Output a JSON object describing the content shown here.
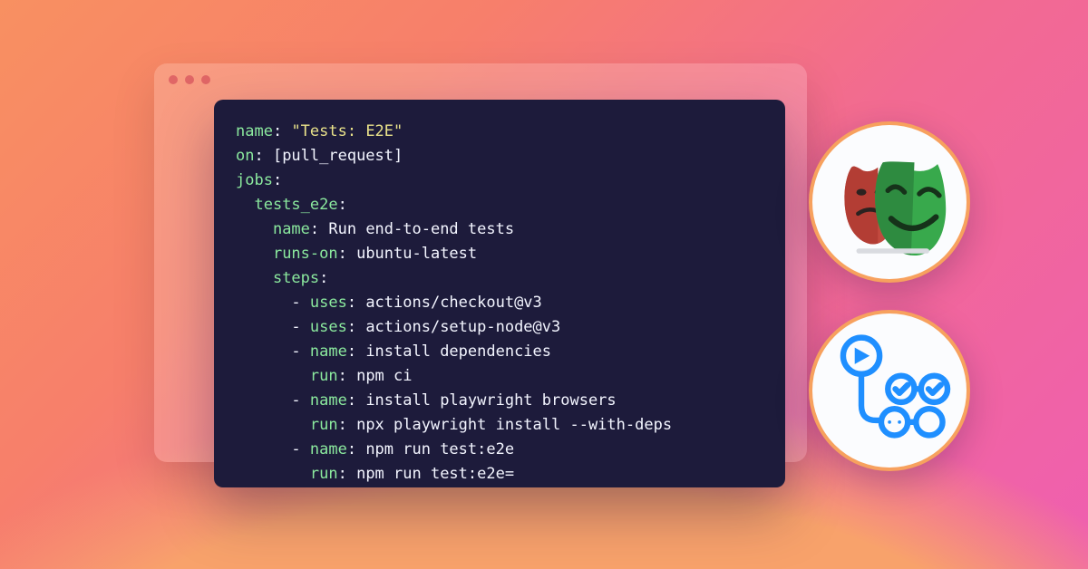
{
  "code": {
    "lines": [
      [
        {
          "cls": "k",
          "t": "name"
        },
        {
          "cls": "s",
          "t": ": "
        },
        {
          "cls": "q",
          "t": "\"Tests: E2E\""
        }
      ],
      [
        {
          "cls": "k",
          "t": "on"
        },
        {
          "cls": "s",
          "t": ": [pull_request]"
        }
      ],
      [
        {
          "cls": "k",
          "t": "jobs"
        },
        {
          "cls": "s",
          "t": ":"
        }
      ],
      [
        {
          "cls": "s",
          "t": "  "
        },
        {
          "cls": "k",
          "t": "tests_e2e"
        },
        {
          "cls": "s",
          "t": ":"
        }
      ],
      [
        {
          "cls": "s",
          "t": "    "
        },
        {
          "cls": "k",
          "t": "name"
        },
        {
          "cls": "s",
          "t": ": Run end-to-end tests"
        }
      ],
      [
        {
          "cls": "s",
          "t": "    "
        },
        {
          "cls": "k",
          "t": "runs-on"
        },
        {
          "cls": "s",
          "t": ": ubuntu-latest"
        }
      ],
      [
        {
          "cls": "s",
          "t": "    "
        },
        {
          "cls": "k",
          "t": "steps"
        },
        {
          "cls": "s",
          "t": ":"
        }
      ],
      [
        {
          "cls": "s",
          "t": "      - "
        },
        {
          "cls": "k",
          "t": "uses"
        },
        {
          "cls": "s",
          "t": ": actions/checkout@v3"
        }
      ],
      [
        {
          "cls": "s",
          "t": "      - "
        },
        {
          "cls": "k",
          "t": "uses"
        },
        {
          "cls": "s",
          "t": ": actions/setup-node@v3"
        }
      ],
      [
        {
          "cls": "s",
          "t": "      - "
        },
        {
          "cls": "k",
          "t": "name"
        },
        {
          "cls": "s",
          "t": ": install dependencies"
        }
      ],
      [
        {
          "cls": "s",
          "t": "        "
        },
        {
          "cls": "k",
          "t": "run"
        },
        {
          "cls": "s",
          "t": ": npm ci"
        }
      ],
      [
        {
          "cls": "s",
          "t": "      - "
        },
        {
          "cls": "k",
          "t": "name"
        },
        {
          "cls": "s",
          "t": ": install playwright browsers"
        }
      ],
      [
        {
          "cls": "s",
          "t": "        "
        },
        {
          "cls": "k",
          "t": "run"
        },
        {
          "cls": "s",
          "t": ": npx playwright install --with-deps"
        }
      ],
      [
        {
          "cls": "s",
          "t": "      - "
        },
        {
          "cls": "k",
          "t": "name"
        },
        {
          "cls": "s",
          "t": ": npm run test:e2e"
        }
      ],
      [
        {
          "cls": "s",
          "t": "        "
        },
        {
          "cls": "k",
          "t": "run"
        },
        {
          "cls": "s",
          "t": ": npm run test:e2e="
        }
      ]
    ]
  },
  "icons": {
    "top": "playwright-masks-icon",
    "bottom": "github-actions-icon"
  }
}
